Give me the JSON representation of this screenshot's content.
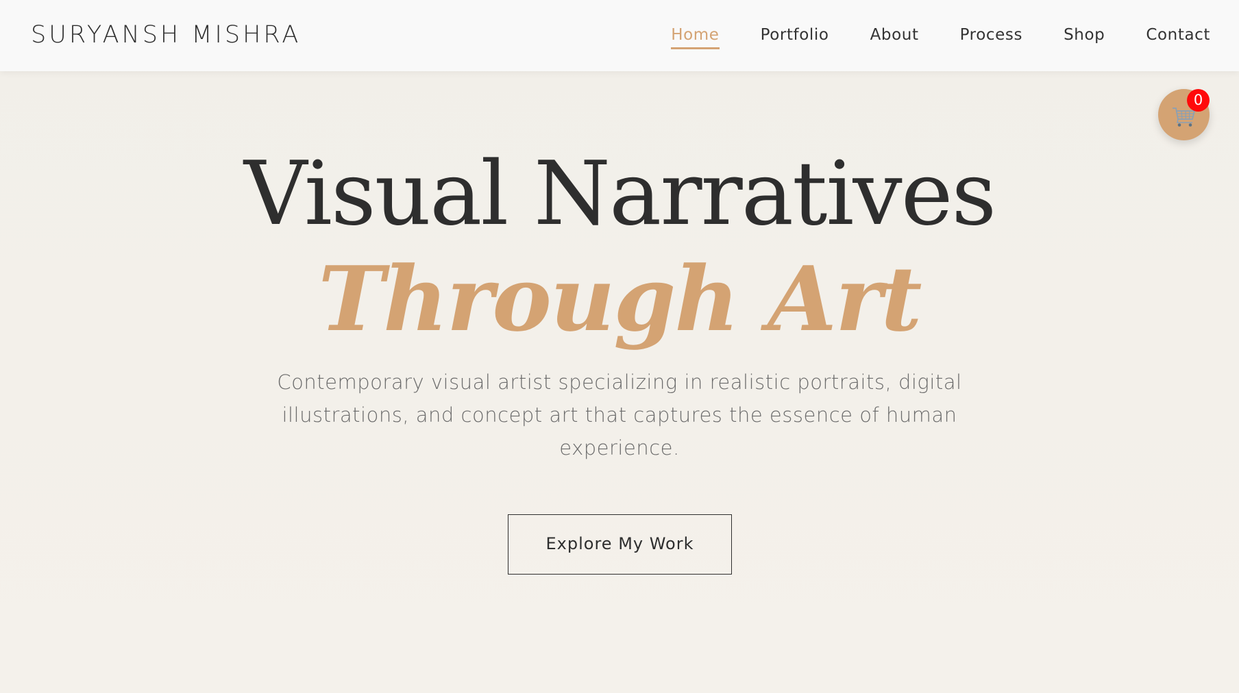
{
  "header": {
    "logo": "SURYANSH MISHRA",
    "nav": [
      {
        "label": "Home",
        "active": true
      },
      {
        "label": "Portfolio",
        "active": false
      },
      {
        "label": "About",
        "active": false
      },
      {
        "label": "Process",
        "active": false
      },
      {
        "label": "Shop",
        "active": false
      },
      {
        "label": "Contact",
        "active": false
      }
    ]
  },
  "cart": {
    "icon": "shopping-cart-icon",
    "count": "0"
  },
  "hero": {
    "title_line1": "Visual Narratives",
    "title_line2": "Through Art",
    "description": "Contemporary visual artist specializing in realistic portraits, digital illustrations, and concept art that captures the essence of human experience.",
    "cta_label": "Explore My Work"
  },
  "colors": {
    "accent": "#d4a373",
    "text_dark": "#2e2e2e",
    "text_muted": "#6b6b6b",
    "background": "#f3f0ea",
    "header_bg": "#f9f9f9",
    "badge": "#ff0a0a"
  }
}
